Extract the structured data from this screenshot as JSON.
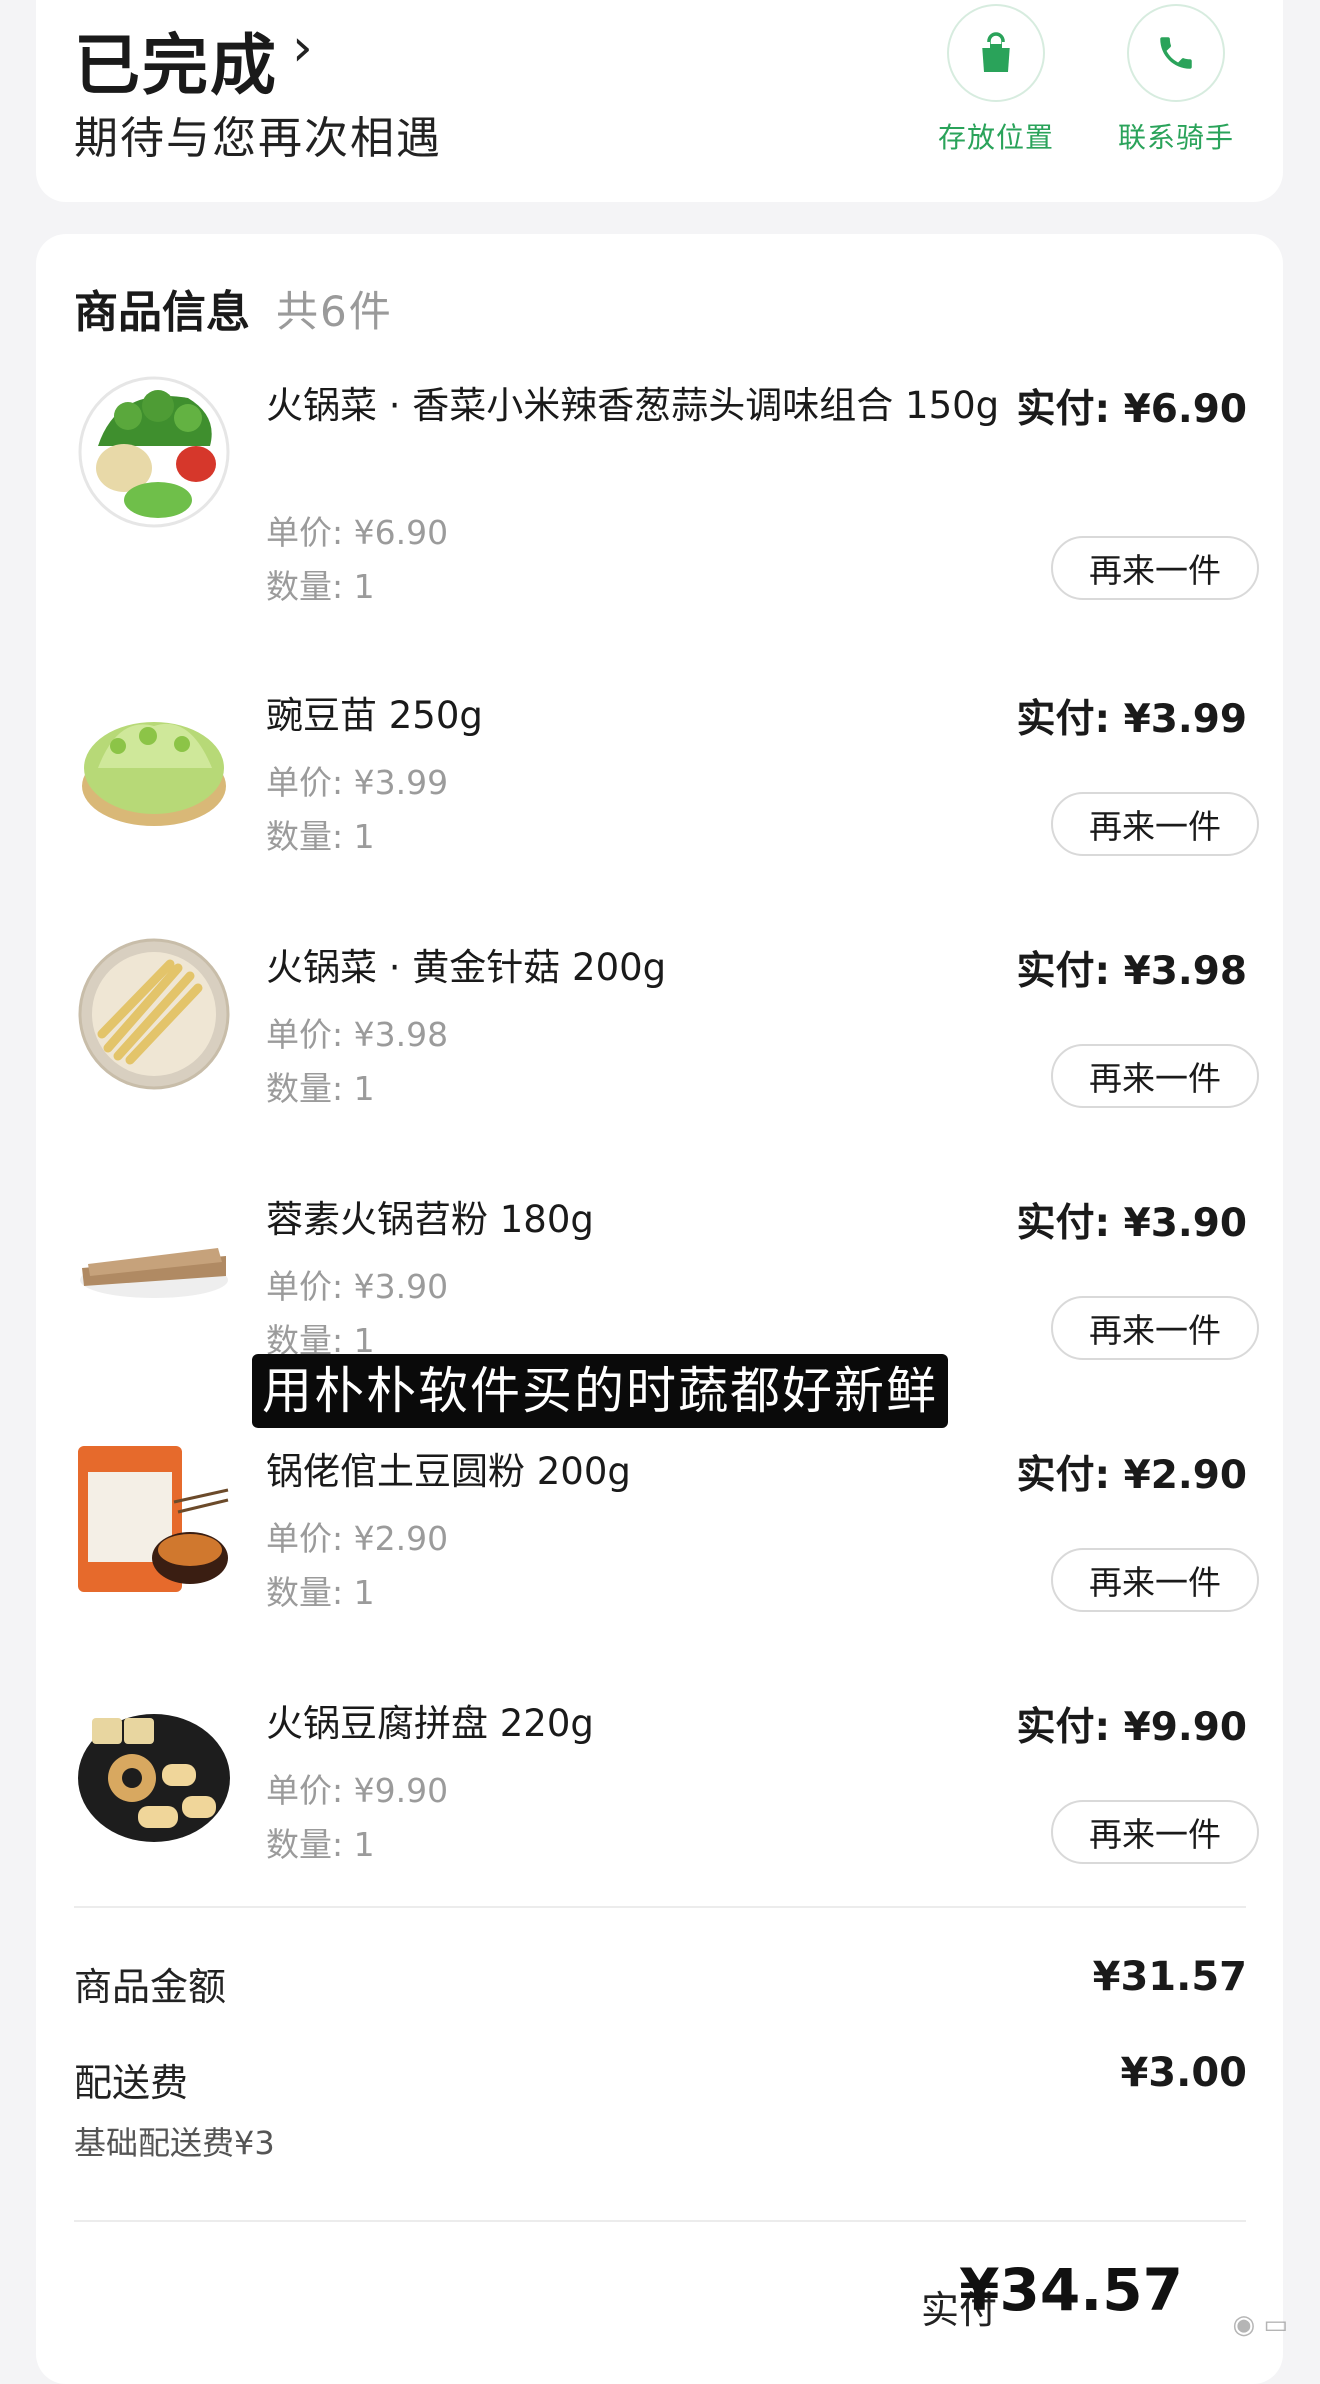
{
  "status": {
    "title": "已完成",
    "subtitle": "期待与您再次相遇",
    "actions": [
      {
        "label": "存放位置",
        "icon": "shopping-bag-icon"
      },
      {
        "label": "联系骑手",
        "icon": "phone-icon"
      }
    ]
  },
  "goods": {
    "title": "商品信息",
    "count": "共6件",
    "reorder_label": "再来一件",
    "items": [
      {
        "name": "火锅菜 · 香菜小米辣香葱蒜头调味组合 150g",
        "paid": "实付: ¥6.90",
        "unit": "单价: ¥6.90",
        "qty": "数量: 1"
      },
      {
        "name": "豌豆苗 250g",
        "paid": "实付: ¥3.99",
        "unit": "单价: ¥3.99",
        "qty": "数量: 1"
      },
      {
        "name": "火锅菜 · 黄金针菇 200g",
        "paid": "实付: ¥3.98",
        "unit": "单价: ¥3.98",
        "qty": "数量: 1"
      },
      {
        "name": "蓉素火锅苕粉 180g",
        "paid": "实付: ¥3.90",
        "unit": "单价: ¥3.90",
        "qty": "数量: 1"
      },
      {
        "name": "锅佬倌土豆圆粉 200g",
        "paid": "实付: ¥2.90",
        "unit": "单价: ¥2.90",
        "qty": "数量: 1"
      },
      {
        "name": "火锅豆腐拼盘 220g",
        "paid": "实付: ¥9.90",
        "unit": "单价: ¥9.90",
        "qty": "数量: 1"
      }
    ]
  },
  "summary": {
    "goods_amount_label": "商品金额",
    "goods_amount": "¥31.57",
    "delivery_label": "配送费",
    "delivery_fee": "¥3.00",
    "delivery_note": "基础配送费¥3",
    "total_label": "实付",
    "total": "¥34.57"
  },
  "caption": "用朴朴软件买的时蔬都好新鲜",
  "colors": {
    "accent_green": "#2aa35a",
    "page_bg": "#f4f4f6"
  }
}
